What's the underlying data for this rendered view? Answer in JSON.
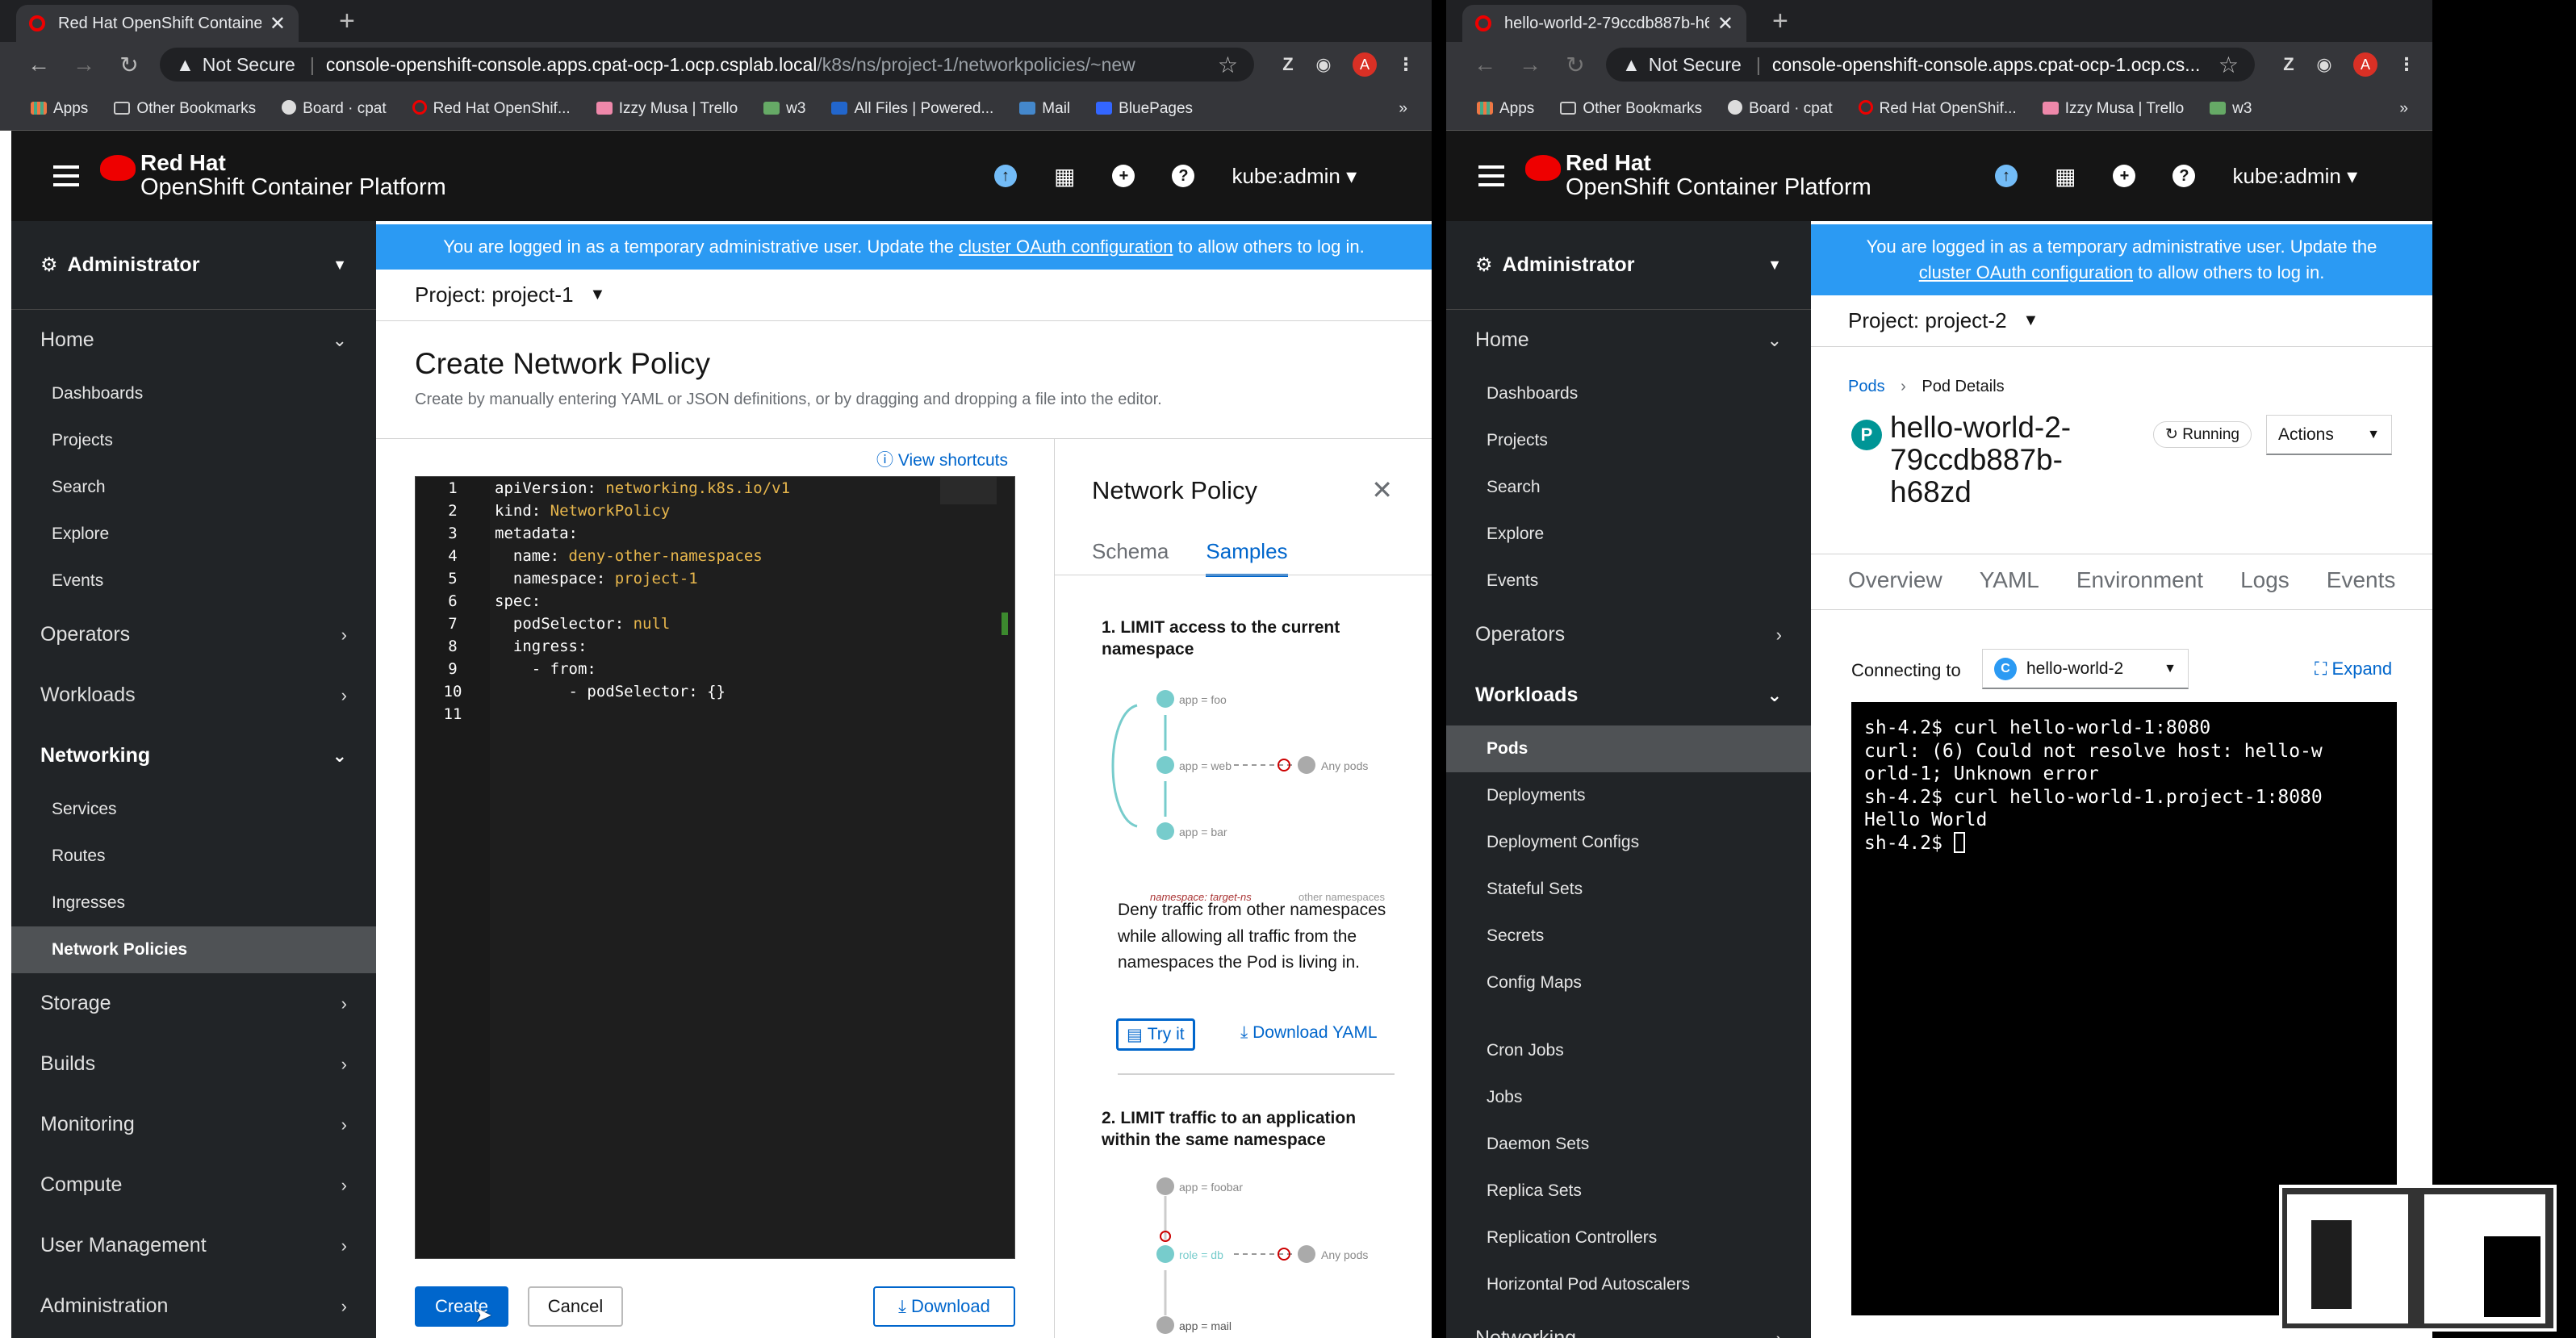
{
  "left": {
    "tab_title": "Red Hat OpenShift Container P",
    "address": {
      "security": "Not Secure",
      "host": "console-openshift-console.apps.cpat-ocp-1.ocp.csplab.local",
      "path": "/k8s/ns/project-1/networkpolicies/~new"
    },
    "bookmarks": [
      "Apps",
      "Other Bookmarks",
      "Board · cpat",
      "Red Hat OpenShif...",
      "Izzy Musa | Trello",
      "w3",
      "All Files | Powered...",
      "Mail",
      "BluePages"
    ],
    "masthead": {
      "brand_line1": "Red Hat",
      "brand_line2": "OpenShift Container Platform",
      "user": "kube:admin"
    },
    "banner": {
      "before": "You are logged in as a temporary administrative user. Update the ",
      "link": "cluster OAuth configuration",
      "after": " to allow others to log in."
    },
    "perspective": "Administrator",
    "nav": {
      "home": "Home",
      "home_items": [
        "Dashboards",
        "Projects",
        "Search",
        "Explore",
        "Events"
      ],
      "operators": "Operators",
      "workloads": "Workloads",
      "networking": "Networking",
      "networking_items": [
        "Services",
        "Routes",
        "Ingresses",
        "Network Policies"
      ],
      "storage": "Storage",
      "builds": "Builds",
      "monitoring": "Monitoring",
      "compute": "Compute",
      "user_management": "User Management",
      "administration": "Administration"
    },
    "project": "Project: project-1",
    "page_title": "Create Network Policy",
    "page_desc": "Create by manually entering YAML or JSON definitions, or by dragging and dropping a file into the editor.",
    "view_shortcuts": "View shortcuts",
    "yaml": [
      {
        "n": "1",
        "k": "apiVersion: ",
        "v": "networking.k8s.io/v1"
      },
      {
        "n": "2",
        "k": "kind: ",
        "v": "NetworkPolicy"
      },
      {
        "n": "3",
        "k": "metadata:",
        "v": ""
      },
      {
        "n": "4",
        "k": "  name: ",
        "v": "deny-other-namespaces"
      },
      {
        "n": "5",
        "k": "  namespace: ",
        "v": "project-1"
      },
      {
        "n": "6",
        "k": "spec:",
        "v": ""
      },
      {
        "n": "7",
        "k": "  podSelector: ",
        "v": "null"
      },
      {
        "n": "8",
        "k": "  ingress:",
        "v": ""
      },
      {
        "n": "9",
        "k": "    - from:",
        "v": ""
      },
      {
        "n": "10",
        "k": "        - podSelector: {}",
        "v": ""
      },
      {
        "n": "11",
        "k": "",
        "v": ""
      }
    ],
    "buttons": {
      "create": "Create",
      "cancel": "Cancel",
      "download": "Download"
    },
    "panel": {
      "title": "Network Policy",
      "tabs": [
        "Schema",
        "Samples"
      ],
      "sample1_title": "1. LIMIT access to the current namespace",
      "sample1_desc": "Deny traffic from other namespaces while allowing all traffic from the namespaces the Pod is living in.",
      "try_it": "Try it",
      "download_yaml": "Download YAML",
      "sample2_title": "2. LIMIT traffic to an application within the same namespace",
      "diagram1": {
        "pods": [
          "app = foo",
          "app = web",
          "app = bar"
        ],
        "any": "Any pods",
        "ns": "namespace: target-ns",
        "other": "other namespaces"
      },
      "diagram2": {
        "pods": [
          "app = foobar",
          "role = db",
          "app = mail"
        ],
        "any": "Any pods"
      }
    }
  },
  "right": {
    "tab_title": "hello-world-2-79ccdb887b-h6",
    "address": {
      "security": "Not Secure",
      "host": "console-openshift-console.apps.cpat-ocp-1.ocp.cs..."
    },
    "bookmarks": [
      "Apps",
      "Other Bookmarks",
      "Board · cpat",
      "Red Hat OpenShif...",
      "Izzy Musa | Trello",
      "w3"
    ],
    "masthead": {
      "brand_line1": "Red Hat",
      "brand_line2": "OpenShift Container Platform",
      "user": "kube:admin"
    },
    "banner": {
      "before": "You are logged in as a temporary administrative user. Update the ",
      "link": "cluster OAuth configuration",
      "after": " to allow others to log in."
    },
    "perspective": "Administrator",
    "nav": {
      "home": "Home",
      "home_items": [
        "Dashboards",
        "Projects",
        "Search",
        "Explore",
        "Events"
      ],
      "operators": "Operators",
      "workloads": "Workloads",
      "workloads_items": [
        "Pods",
        "Deployments",
        "Deployment Configs",
        "Stateful Sets",
        "Secrets",
        "Config Maps",
        "Cron Jobs",
        "Jobs",
        "Daemon Sets",
        "Replica Sets",
        "Replication Controllers",
        "Horizontal Pod Autoscalers"
      ],
      "networking": "Networking"
    },
    "project": "Project: project-2",
    "breadcrumb": {
      "pods": "Pods",
      "current": "Pod Details"
    },
    "pod_badge": "P",
    "pod_name_lines": [
      "hello-world-2-",
      "79ccdb887b-",
      "h68zd"
    ],
    "status": "Running",
    "actions": "Actions",
    "tabs": [
      "Overview",
      "YAML",
      "Environment",
      "Logs",
      "Events"
    ],
    "connecting_to": "Connecting to",
    "container_badge": "C",
    "container": "hello-world-2",
    "expand": "Expand",
    "terminal_lines": [
      "sh-4.2$ curl hello-world-1:8080",
      "curl: (6) Could not resolve host: hello-w",
      "orld-1; Unknown error",
      "sh-4.2$ curl hello-world-1.project-1:8080",
      "Hello World",
      "sh-4.2$ "
    ]
  }
}
